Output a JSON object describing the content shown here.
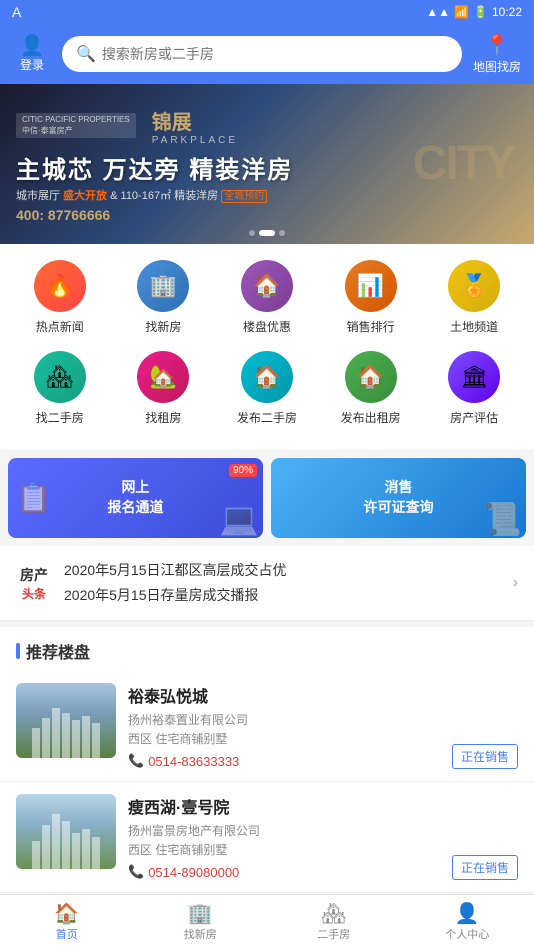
{
  "statusBar": {
    "leftIcon": "A",
    "time": "10:22",
    "signal": "▲▲",
    "wifi": "WiFi",
    "battery": "🔋"
  },
  "header": {
    "loginLabel": "登录",
    "searchPlaceholder": "搜索新房或二手房",
    "mapLabel": "地图找房"
  },
  "banner": {
    "citicLogo": "CITIC PACIFIC PROPERTIES\n中信·泰富房产",
    "projectName": "锦",
    "projectNameFull": "锦展",
    "mainTitle": "主城芯 万达旁 精装洋房",
    "subtitle": "城市展厅 盛大开放 & 110-167㎡ 精装洋房 全城预约",
    "highlight": "盛大开放",
    "phone": "400: 87766666",
    "cityText": "CITY",
    "dots": 3,
    "activeDot": 1
  },
  "iconGrid": {
    "row1": [
      {
        "label": "热点新闻",
        "icon": "🔥",
        "colorClass": "ic-red"
      },
      {
        "label": "找新房",
        "icon": "🏢",
        "colorClass": "ic-blue"
      },
      {
        "label": "楼盘优惠",
        "icon": "🏠",
        "colorClass": "ic-purple"
      },
      {
        "label": "销售排行",
        "icon": "📊",
        "colorClass": "ic-orange"
      },
      {
        "label": "土地频道",
        "icon": "🏅",
        "colorClass": "ic-gold"
      }
    ],
    "row2": [
      {
        "label": "找二手房",
        "icon": "🏘",
        "colorClass": "ic-cyan"
      },
      {
        "label": "找租房",
        "icon": "🏡",
        "colorClass": "ic-pink"
      },
      {
        "label": "发布二手房",
        "icon": "🏠",
        "colorClass": "ic-teal"
      },
      {
        "label": "发布出租房",
        "icon": "🏠",
        "colorClass": "ic-green"
      },
      {
        "label": "房产评估",
        "icon": "🏛",
        "colorClass": "ic-violet"
      }
    ]
  },
  "promos": [
    {
      "line1": "网上",
      "line2": "报名通道",
      "badge": "90%",
      "colorClass": "promo-left"
    },
    {
      "line1": "消售",
      "line2": "许可证查询",
      "badge": "",
      "colorClass": "promo-right"
    }
  ],
  "news": {
    "tagTop": "房产",
    "tagBottom": "头条",
    "items": [
      "2020年5月15日江都区高层成交占优",
      "2020年5月15日存量房成交播报"
    ]
  },
  "recommended": {
    "sectionTitle": "推荐楼盘",
    "properties": [
      {
        "name": "裕泰弘悦城",
        "company": "扬州裕泰置业有限公司",
        "area": "西区 住宅商铺别墅",
        "phone": "0514-83633333",
        "status": "正在销售"
      },
      {
        "name": "瘦西湖·壹号院",
        "company": "扬州富景房地产有限公司",
        "area": "西区 住宅商铺别墅",
        "phone": "0514-89080000",
        "status": "正在销售"
      }
    ]
  },
  "bottomNav": [
    {
      "icon": "🏠",
      "label": "首页",
      "active": true
    },
    {
      "icon": "🏢",
      "label": "找新房",
      "active": false
    },
    {
      "icon": "🏘",
      "label": "二手房",
      "active": false
    },
    {
      "icon": "👤",
      "label": "个人中心",
      "active": false
    }
  ]
}
